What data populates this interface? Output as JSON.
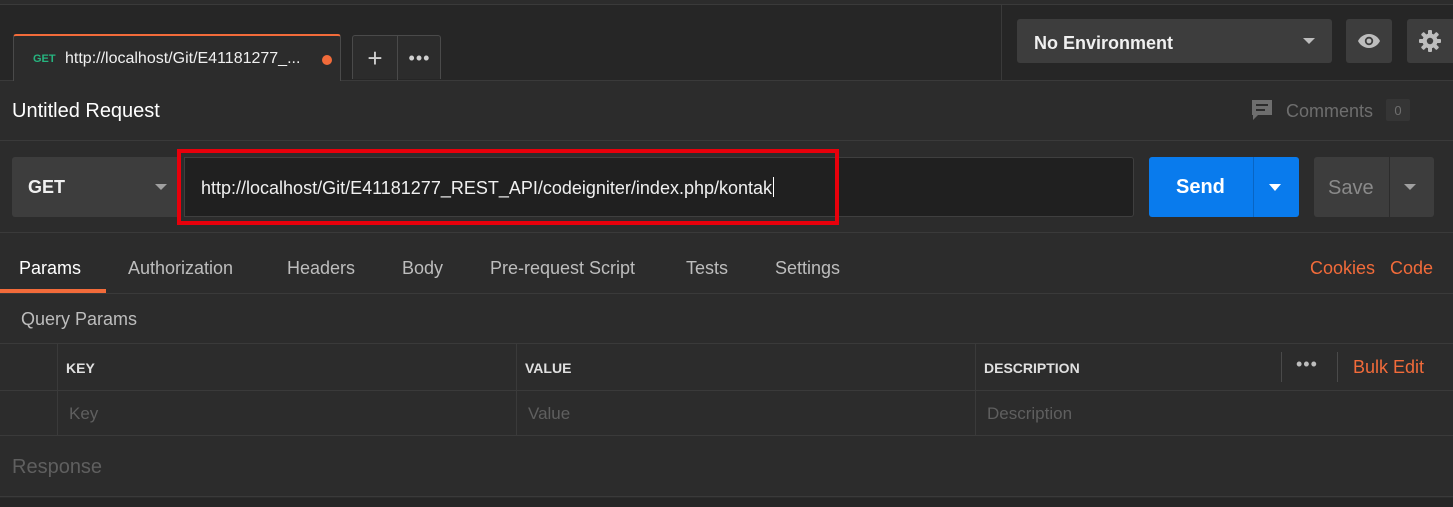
{
  "tab": {
    "method": "GET",
    "url": "http://localhost/Git/E41181277_..."
  },
  "tab_actions": {
    "add": "+",
    "more": "•••"
  },
  "environment": {
    "selected": "No Environment"
  },
  "request": {
    "title": "Untitled Request"
  },
  "comments": {
    "label": "Comments",
    "count": "0"
  },
  "url_bar": {
    "method": "GET",
    "url": "http://localhost/Git/E41181277_REST_API/codeigniter/index.php/kontak",
    "send_label": "Send",
    "save_label": "Save"
  },
  "subtabs": [
    "Params",
    "Authorization",
    "Headers",
    "Body",
    "Pre-request Script",
    "Tests",
    "Settings"
  ],
  "subtab_links": {
    "cookies": "Cookies",
    "code": "Code"
  },
  "params": {
    "title": "Query Params",
    "headers": {
      "key": "KEY",
      "value": "VALUE",
      "description": "DESCRIPTION"
    },
    "placeholders": {
      "key": "Key",
      "value": "Value",
      "description": "Description"
    },
    "more": "•••",
    "bulk_edit": "Bulk Edit"
  },
  "response": {
    "label": "Response"
  },
  "colors": {
    "accent": "#f26b3a",
    "send": "#097bed",
    "method_green": "#26b47f",
    "highlight_red": "#e8000b"
  }
}
